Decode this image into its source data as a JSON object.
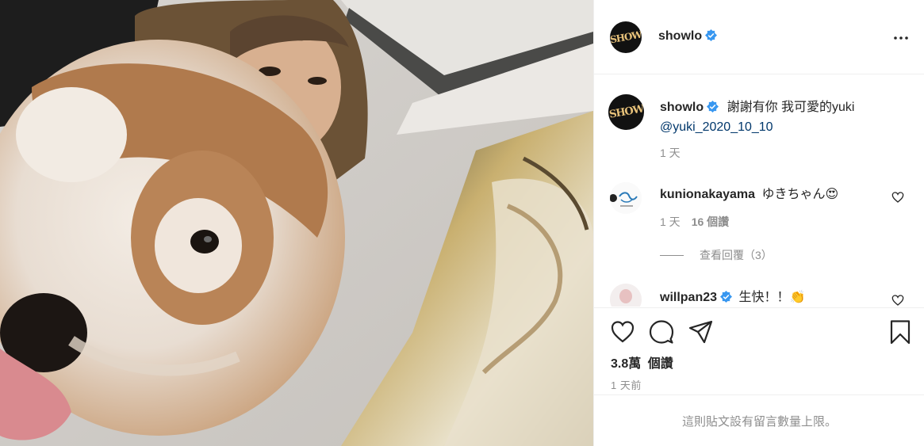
{
  "post": {
    "author": "showlo",
    "avatar_text": "SHOW",
    "caption_text": "謝謝有你 我可愛的yuki",
    "caption_mention": "@yuki_2020_10_10",
    "caption_time": "1 天"
  },
  "comments": [
    {
      "user": "kunionakayama",
      "text": "ゆきちゃん",
      "emoji": "😍",
      "time": "1 天",
      "likes": "16 個讚",
      "replies": "查看回覆（3）"
    },
    {
      "user": "willpan23",
      "text": "生快！！",
      "emoji": "👏"
    }
  ],
  "actions": {
    "like_icon": "heart-icon",
    "comment_icon": "comment-icon",
    "share_icon": "share-icon",
    "save_icon": "bookmark-icon",
    "likes_count": "3.8萬",
    "likes_label": "個讚",
    "posted": "1 天前"
  },
  "footer_text": "這則貼文設有留言數量上限。",
  "colors": {
    "verified": "#3897f0",
    "mention": "#00376b",
    "muted": "#8e8e8e"
  }
}
